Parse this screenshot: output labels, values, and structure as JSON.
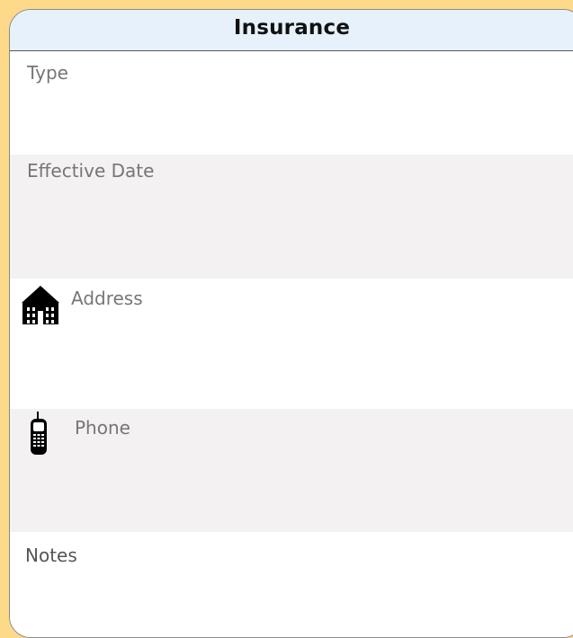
{
  "form": {
    "title": "Insurance",
    "fields": {
      "type": {
        "label": "Type"
      },
      "effective_date": {
        "label": "Effective Date"
      },
      "address": {
        "label": "Address",
        "icon": "house-icon"
      },
      "phone": {
        "label": "Phone",
        "icon": "mobile-phone-icon"
      },
      "notes": {
        "label": "Notes"
      }
    }
  },
  "colors": {
    "page_background": "#fdd98a",
    "header_background": "#e6f1fb",
    "alt_row": "#f3f1f1",
    "label": "#767676"
  }
}
